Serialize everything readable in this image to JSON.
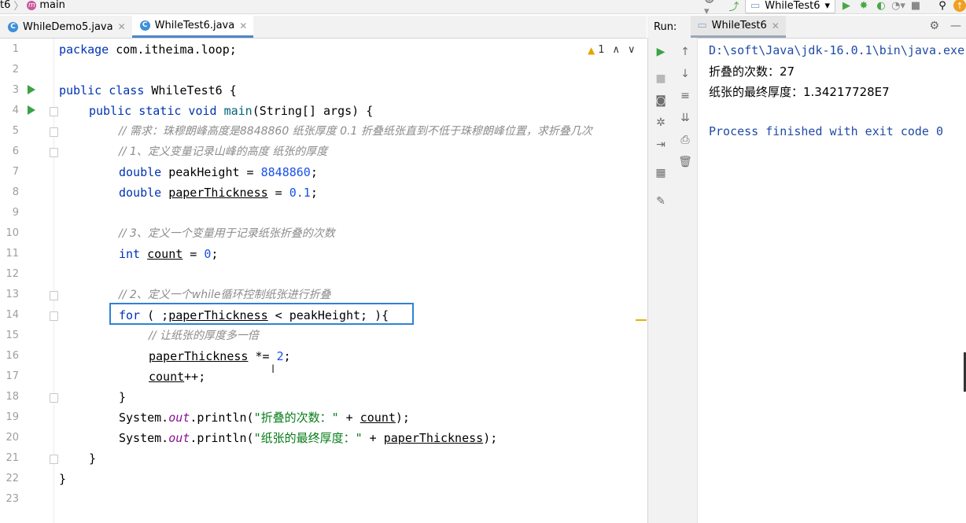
{
  "breadcrumb": {
    "first": "t6",
    "module_icon": "m",
    "branch": "main"
  },
  "toolbar": {
    "run_config": "WhileTest6"
  },
  "editor_tabs": [
    {
      "label": "WhileDemo5.java",
      "icon": "class-icon",
      "active": false
    },
    {
      "label": "WhileTest6.java",
      "icon": "class-icon",
      "active": true
    }
  ],
  "inspection": {
    "warnings": "1"
  },
  "line_numbers": [
    "1",
    "2",
    "3",
    "4",
    "5",
    "6",
    "7",
    "8",
    "9",
    "10",
    "11",
    "12",
    "13",
    "14",
    "15",
    "16",
    "17",
    "18",
    "19",
    "20",
    "21",
    "22",
    "23"
  ],
  "code": {
    "l1_kw": "package",
    "l1_rest": " com.itheima.loop;",
    "l3_kw": "public class",
    "l3_rest": " WhileTest6 {",
    "l4_kw": "public static void",
    "l4_fn": " main",
    "l4_rest": "(String[] args) {",
    "l5": "// 需求：珠穆朗峰高度是8848860 纸张厚度 0.1 折叠纸张直到不低于珠穆朗峰位置，求折叠几次",
    "l6": "// 1、定义变量记录山峰的高度 纸张的厚度",
    "l7_kw": "double",
    "l7_mid": " peakHeight = ",
    "l7_num": "8848860",
    "l7_end": ";",
    "l8_kw": "double",
    "l8_var": "paperThickness",
    "l8_mid": " = ",
    "l8_num": "0.1",
    "l8_end": ";",
    "l10": "// 3、定义一个变量用于记录纸张折叠的次数",
    "l11_kw": "int",
    "l11_var": "count",
    "l11_mid": " = ",
    "l11_num": "0",
    "l11_end": ";",
    "l13": "// 2、定义一个while循环控制纸张进行折叠",
    "l14_kw": "for",
    "l14_a": " ( ;",
    "l14_var": "paperThickness",
    "l14_b": " < peakHeight; ){",
    "l15": "// 让纸张的厚度多一倍",
    "l16_var": "paperThickness",
    "l16_mid": " *= ",
    "l16_num": "2",
    "l16_end": ";",
    "l17_var": "count",
    "l17_end": "++;",
    "l18": "}",
    "l19_a": "System.",
    "l19_fld": "out",
    "l19_b": ".println(",
    "l19_str": "\"折叠的次数：\"",
    "l19_c": " + ",
    "l19_var": "count",
    "l19_d": ");",
    "l20_a": "System.",
    "l20_fld": "out",
    "l20_b": ".println(",
    "l20_str": "\"纸张的最终厚度：\"",
    "l20_c": " + ",
    "l20_var": "paperThickness",
    "l20_d": ");",
    "l21": "}",
    "l22": "}"
  },
  "run_panel": {
    "label": "Run:",
    "tab": "WhileTest6",
    "console": [
      "D:\\soft\\Java\\jdk-16.0.1\\bin\\java.exe",
      "折叠的次数：27",
      "纸张的最终厚度：1.34217728E7",
      "",
      "Process finished with exit code 0"
    ]
  }
}
